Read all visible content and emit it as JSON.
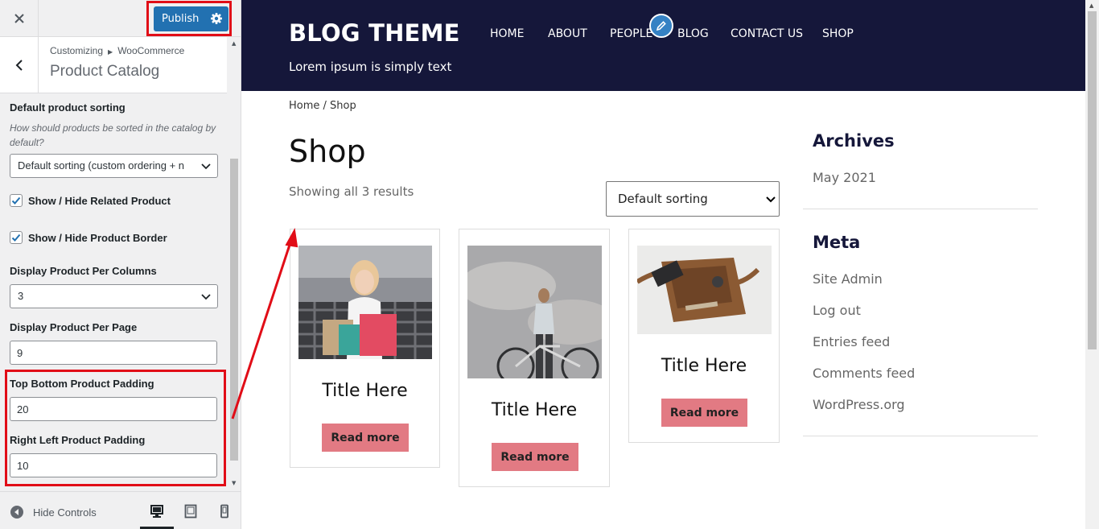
{
  "customizer": {
    "close_icon": "close-icon",
    "publish_label": "Publish",
    "breadcrumb": {
      "root": "Customizing",
      "parent": "WooCommerce"
    },
    "section_title": "Product Catalog",
    "controls": {
      "sorting_label": "Default product sorting",
      "sorting_desc": "How should products be sorted in the catalog by default?",
      "sorting_value": "Default sorting (custom ordering + n",
      "related_label": "Show / Hide Related Product",
      "related_checked": true,
      "border_label": "Show / Hide Product Border",
      "border_checked": true,
      "columns_label": "Display Product Per Columns",
      "columns_value": "3",
      "per_page_label": "Display Product Per Page",
      "per_page_value": "9",
      "tb_padding_label": "Top Bottom Product Padding",
      "tb_padding_value": "20",
      "rl_padding_label": "Right Left Product Padding",
      "rl_padding_value": "10"
    },
    "footer": {
      "hide_controls": "Hide Controls",
      "devices": [
        "desktop-icon",
        "tablet-icon",
        "mobile-icon"
      ],
      "active_device": "desktop"
    }
  },
  "site": {
    "title": "BLOG THEME",
    "tagline": "Lorem ipsum is simply text",
    "nav": [
      "HOME",
      "ABOUT",
      "PEOPLE",
      "BLOG",
      "CONTACT US",
      "SHOP"
    ],
    "breadcrumb": "Home / Shop",
    "page_title": "Shop",
    "result_count": "Showing all 3 results",
    "orderby": "Default sorting",
    "products": [
      {
        "title": "Title Here",
        "button": "Read more",
        "image": "woman-shopping-bags"
      },
      {
        "title": "Title Here",
        "button": "Read more",
        "image": "man-with-bicycle"
      },
      {
        "title": "Title Here",
        "button": "Read more",
        "image": "leather-bag-accessories"
      }
    ],
    "sidebar": {
      "archives_title": "Archives",
      "archives": [
        "May 2021"
      ],
      "meta_title": "Meta",
      "meta_links": [
        "Site Admin",
        "Log out",
        "Entries feed",
        "Comments feed",
        "WordPress.org"
      ]
    }
  },
  "colors": {
    "publish": "#2271b1",
    "highlight": "#e10d17",
    "header_bg": "#15173a",
    "button_bg": "#e27a83"
  }
}
